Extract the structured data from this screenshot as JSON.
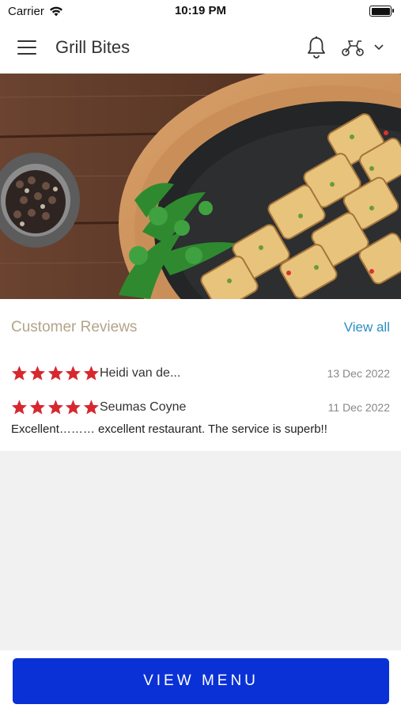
{
  "status_bar": {
    "carrier": "Carrier",
    "time": "10:19 PM"
  },
  "header": {
    "title": "Grill Bites",
    "icons": [
      "menu-icon",
      "bell-icon",
      "delivery-scooter-icon",
      "chevron-down-icon"
    ]
  },
  "hero": {
    "description_icon": "food-photo"
  },
  "reviews": {
    "title": "Customer Reviews",
    "view_all_label": "View all",
    "star_color": "#d7282f",
    "items": [
      {
        "rating": 5,
        "name": "Heidi van de...",
        "date": "13 Dec 2022",
        "text": ""
      },
      {
        "rating": 5,
        "name": "Seumas Coyne",
        "date": "11 Dec 2022",
        "text": "Excellent……… excellent restaurant. The service is superb!!"
      }
    ]
  },
  "footer": {
    "view_menu_label": "VIEW MENU",
    "button_color": "#0a31d6"
  }
}
